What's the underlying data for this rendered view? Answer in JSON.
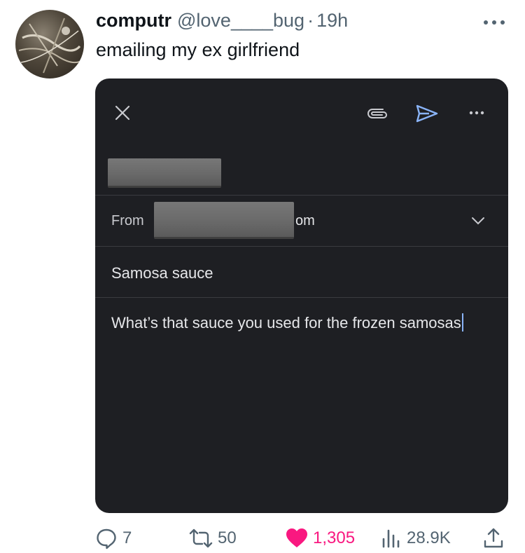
{
  "tweet": {
    "display_name": "computr",
    "handle": "@love____bug",
    "separator": "·",
    "time": "19h",
    "text": "emailing my ex girlfriend"
  },
  "email_screenshot": {
    "from_label": "From",
    "from_visible_suffix": "om",
    "subject": "Samosa sauce",
    "body": "What’s that sauce you used for the frozen samosas",
    "colors": {
      "background": "#1e1f23",
      "send_icon": "#8ab4f8",
      "text": "#e6e7ea"
    },
    "icons": [
      "close-icon",
      "attachment-icon",
      "send-icon",
      "more-vertical-icon",
      "chevron-down-icon"
    ]
  },
  "actions": {
    "replies": "7",
    "retweets": "50",
    "likes": "1,305",
    "views": "28.9K"
  },
  "colors": {
    "like": "#f91880",
    "muted": "#536471"
  }
}
